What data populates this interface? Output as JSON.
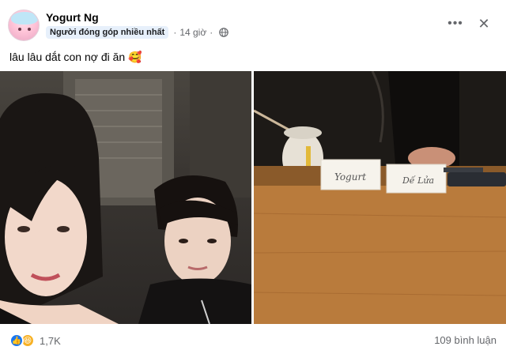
{
  "post": {
    "author": "Yogurt Ng",
    "badge": "Người đóng góp nhiều nhất",
    "time": "14 giờ",
    "privacy_icon": "globe-icon",
    "text": "lâu lâu dắt con nợ đi ăn 🥰"
  },
  "photos": {
    "left": "selfie-photo",
    "right": "restaurant-photo",
    "place_cards": [
      "Yogurt",
      "Dế Lửa"
    ]
  },
  "footer": {
    "reaction_icons": [
      "like-icon",
      "haha-icon"
    ],
    "reaction_count": "1,7K",
    "comments": "109 bình luận"
  },
  "colors": {
    "link_blue": "#1877f2",
    "secondary_text": "#65676b",
    "badge_bg": "#e7f0fb"
  }
}
